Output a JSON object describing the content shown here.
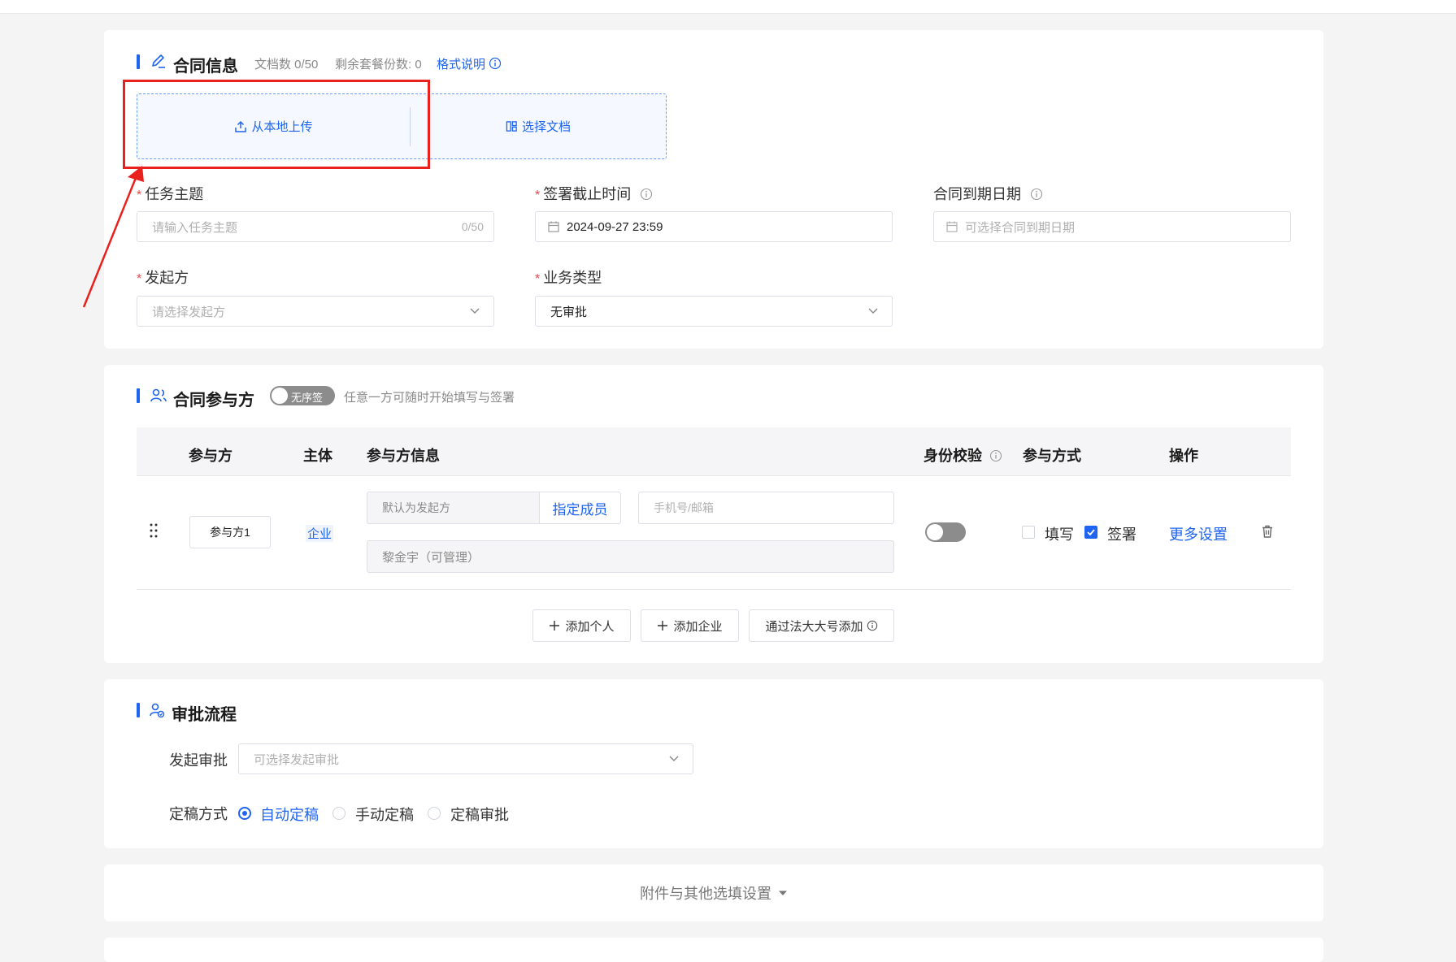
{
  "contract_info": {
    "title": "合同信息",
    "doc_count": "文档数 0/50",
    "remaining": "剩余套餐份数: 0",
    "format_help": "格式说明",
    "upload_local": "从本地上传",
    "select_doc": "选择文档",
    "task_subject": {
      "label": "任务主题",
      "placeholder": "请输入任务主题",
      "counter": "0/50"
    },
    "sign_deadline": {
      "label": "签署截止时间",
      "value": "2024-09-27 23:59"
    },
    "expiry_date": {
      "label": "合同到期日期",
      "placeholder": "可选择合同到期日期"
    },
    "initiator": {
      "label": "发起方",
      "placeholder": "请选择发起方"
    },
    "business_type": {
      "label": "业务类型",
      "value": "无审批"
    }
  },
  "participants": {
    "title": "合同参与方",
    "toggle_label": "无序签",
    "hint": "任意一方可随时开始填写与签署",
    "columns": [
      "参与方",
      "主体",
      "参与方信息",
      "身份校验",
      "参与方式",
      "操作"
    ],
    "row": {
      "name": "参与方1",
      "entity": "企业",
      "default_initiator": "默认为发起方",
      "assign_member": "指定成员",
      "phone_placeholder": "手机号/邮箱",
      "member": "黎金宇（可管理）",
      "fill": "填写",
      "sign": "签署",
      "more": "更多设置"
    },
    "add_person": "添加个人",
    "add_company": "添加企业",
    "add_via": "通过法大大号添加"
  },
  "approval": {
    "title": "审批流程",
    "initiate_label": "发起审批",
    "initiate_placeholder": "可选择发起审批",
    "finalize_label": "定稿方式",
    "options": [
      "自动定稿",
      "手动定稿",
      "定稿审批"
    ]
  },
  "attachments": {
    "label": "附件与其他选填设置"
  },
  "colors": {
    "accent": "#1f64f0",
    "annotation": "#e8211d",
    "required": "#e5484d"
  }
}
